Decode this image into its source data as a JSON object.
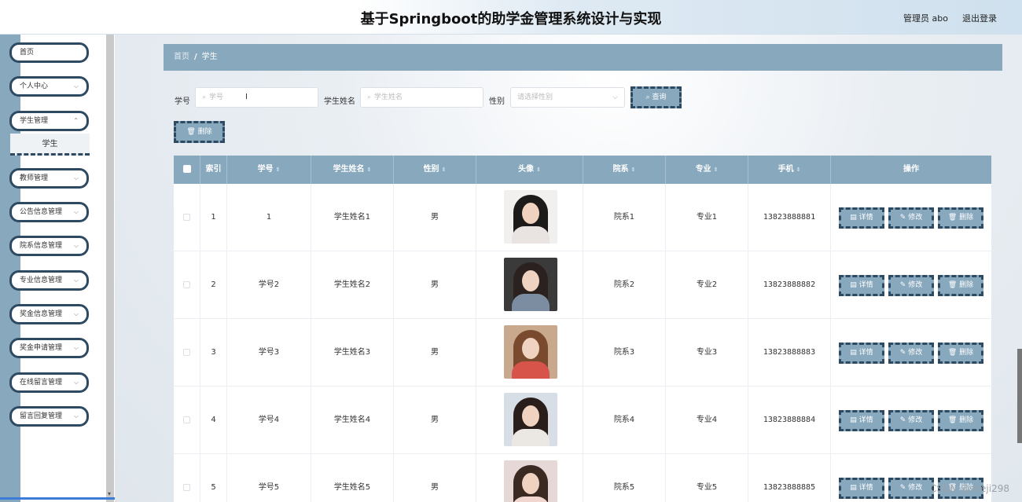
{
  "header": {
    "title": "基于Springboot的助学金管理系统设计与实现",
    "user": "管理员 abo",
    "logout": "退出登录"
  },
  "sidebar": {
    "items": [
      {
        "label": "首页"
      },
      {
        "label": "个人中心"
      },
      {
        "label": "学生管理"
      },
      {
        "label": "教师管理"
      },
      {
        "label": "公告信息管理"
      },
      {
        "label": "院系信息管理"
      },
      {
        "label": "专业信息管理"
      },
      {
        "label": "奖金信息管理"
      },
      {
        "label": "奖金申请管理"
      },
      {
        "label": "在线留言管理"
      },
      {
        "label": "留言回复管理"
      }
    ],
    "subitem": "学生"
  },
  "breadcrumb": {
    "home": "首页",
    "sep": "/",
    "current": "学生"
  },
  "filters": {
    "student_no_label": "学号",
    "student_no_placeholder": "学号",
    "student_name_label": "学生姓名",
    "student_name_placeholder": "学生姓名",
    "gender_label": "性别",
    "gender_placeholder": "请选择性别",
    "search_label": "查询",
    "bulk_delete_label": "删除"
  },
  "table": {
    "headers": [
      "索引",
      "学号",
      "学生姓名",
      "性别",
      "头像",
      "院系",
      "专业",
      "手机",
      "操作"
    ],
    "rows": [
      {
        "index": "1",
        "student_no": "1",
        "name": "学生姓名1",
        "gender": "男",
        "dept": "院系1",
        "major": "专业1",
        "phone": "13823888881"
      },
      {
        "index": "2",
        "student_no": "学号2",
        "name": "学生姓名2",
        "gender": "男",
        "dept": "院系2",
        "major": "专业2",
        "phone": "13823888882"
      },
      {
        "index": "3",
        "student_no": "学号3",
        "name": "学生姓名3",
        "gender": "男",
        "dept": "院系3",
        "major": "专业3",
        "phone": "13823888883"
      },
      {
        "index": "4",
        "student_no": "学号4",
        "name": "学生姓名4",
        "gender": "男",
        "dept": "院系4",
        "major": "专业4",
        "phone": "13823888884"
      },
      {
        "index": "5",
        "student_no": "学号5",
        "name": "学生姓名5",
        "gender": "男",
        "dept": "院系5",
        "major": "专业5",
        "phone": "13823888885"
      }
    ],
    "actions": {
      "detail": "详情",
      "edit": "修改",
      "delete": "删除"
    }
  },
  "watermark": "CSDN @sheji298",
  "colors": {
    "accent": "#88a8bd",
    "border_dark": "#2e4a62"
  }
}
